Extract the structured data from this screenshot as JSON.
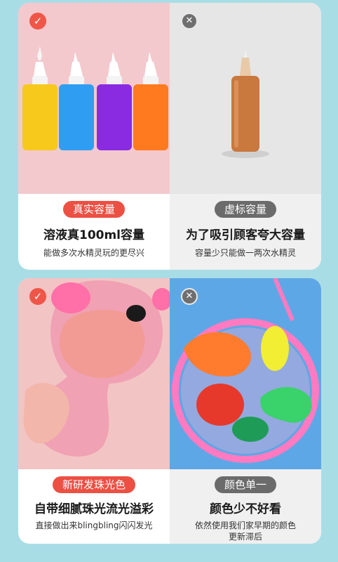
{
  "top": {
    "left": {
      "badge": "✓",
      "tag": "真实容量",
      "headline": "溶液真100ml容量",
      "sub": "能做多次水精灵玩的更尽兴"
    },
    "right": {
      "badge": "✕",
      "tag": "虚标容量",
      "headline": "为了吸引顾客夸大容量",
      "sub": "容量少只能做一两次水精灵"
    }
  },
  "bottom": {
    "left": {
      "badge": "✓",
      "tag": "新研发珠光色",
      "headline": "自带细腻珠光流光溢彩",
      "sub": "直接做出来blingbling闪闪发光"
    },
    "right": {
      "badge": "✕",
      "tag": "颜色单一",
      "headline": "颜色少不好看",
      "sub_line1": "依然使用我们家早期的颜色",
      "sub_line2": "更新滞后"
    }
  },
  "colors": {
    "page_bg": "#a9dde6",
    "accent_red": "#eb5043",
    "neutral_gray": "#6b6b6b",
    "bottle_yellow": "#f6c51c",
    "bottle_blue": "#2e9df0",
    "bottle_purple": "#8a2be2",
    "bottle_orange": "#ff7a1f"
  }
}
